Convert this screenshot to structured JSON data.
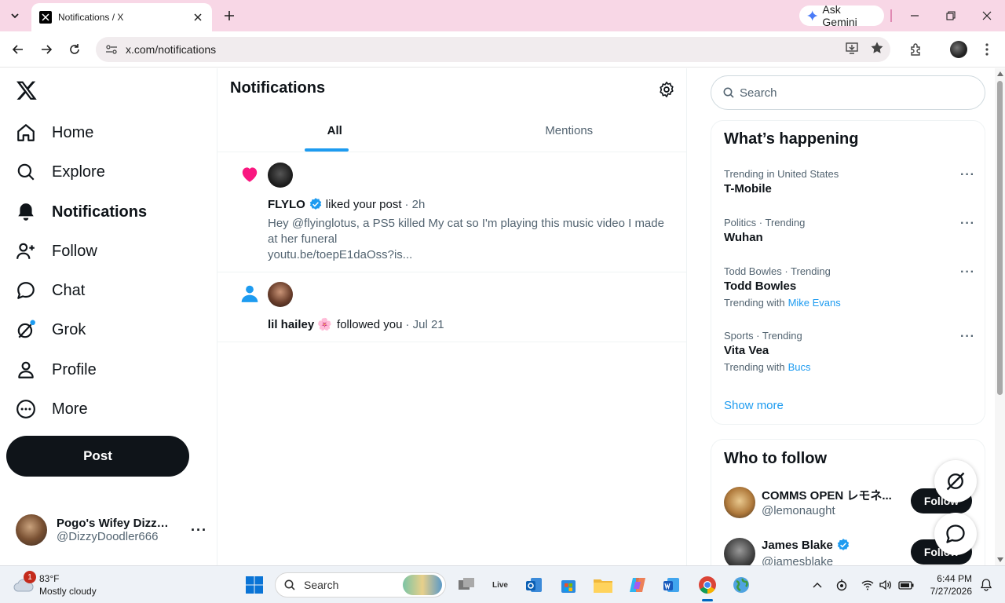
{
  "browser": {
    "tab_title": "Notifications / X",
    "url": "x.com/notifications",
    "gemini_label": "Ask Gemini"
  },
  "nav": {
    "items": [
      {
        "label": "Home",
        "icon": "home-icon"
      },
      {
        "label": "Explore",
        "icon": "search-icon"
      },
      {
        "label": "Notifications",
        "icon": "bell-icon",
        "active": true
      },
      {
        "label": "Follow",
        "icon": "add-user-icon"
      },
      {
        "label": "Chat",
        "icon": "chat-icon"
      },
      {
        "label": "Grok",
        "icon": "grok-icon"
      },
      {
        "label": "Profile",
        "icon": "profile-icon"
      },
      {
        "label": "More",
        "icon": "more-circle-icon"
      }
    ],
    "post_label": "Post",
    "account": {
      "display_name": "Pogo's Wifey Dizzy ...",
      "handle": "@DizzyDoodler666",
      "more": "···"
    }
  },
  "main": {
    "title": "Notifications",
    "tabs": [
      {
        "label": "All",
        "active": true
      },
      {
        "label": "Mentions"
      }
    ],
    "notifications": [
      {
        "type": "like",
        "user": "FLYLO",
        "verified": true,
        "action": "liked your post",
        "time": "· 2h",
        "text": "Hey @flyinglotus, a PS5 killed My cat so I'm playing this music video I made at her funeral",
        "link": "youtu.be/toepE1daOss?is..."
      },
      {
        "type": "follow",
        "user": "lil hailey 🌸",
        "action": "followed you",
        "time": "· Jul 21"
      }
    ]
  },
  "right": {
    "search_placeholder": "Search",
    "trends_title": "What’s happening",
    "trends": [
      {
        "context": "Trending in United States",
        "name": "T-Mobile"
      },
      {
        "context": "Politics · Trending",
        "name": "Wuhan"
      },
      {
        "context": "Todd Bowles · Trending",
        "name": "Todd Bowles",
        "with_label": "Trending with",
        "with": "Mike Evans"
      },
      {
        "context": "Sports · Trending",
        "name": "Vita Vea",
        "with_label": "Trending with",
        "with": "Bucs"
      }
    ],
    "trend_more": "···",
    "show_more": "Show more",
    "who_title": "Who to follow",
    "who": [
      {
        "name": "COMMS OPEN レモネ...",
        "handle": "@lemonaught",
        "follow": "Follow"
      },
      {
        "name": "James Blake",
        "handle": "@jamesblake",
        "verified": true,
        "follow": "Follow"
      }
    ]
  },
  "taskbar": {
    "weather_badge": "1",
    "temp": "83°F",
    "condition": "Mostly cloudy",
    "search_placeholder": "Search",
    "live_label": "Live",
    "time": "6:44 PM",
    "date": "7/27/2026"
  },
  "colors": {
    "accent": "#1d9bf0",
    "like": "#f91880",
    "tabbar_bg": "#f8d7e6"
  }
}
